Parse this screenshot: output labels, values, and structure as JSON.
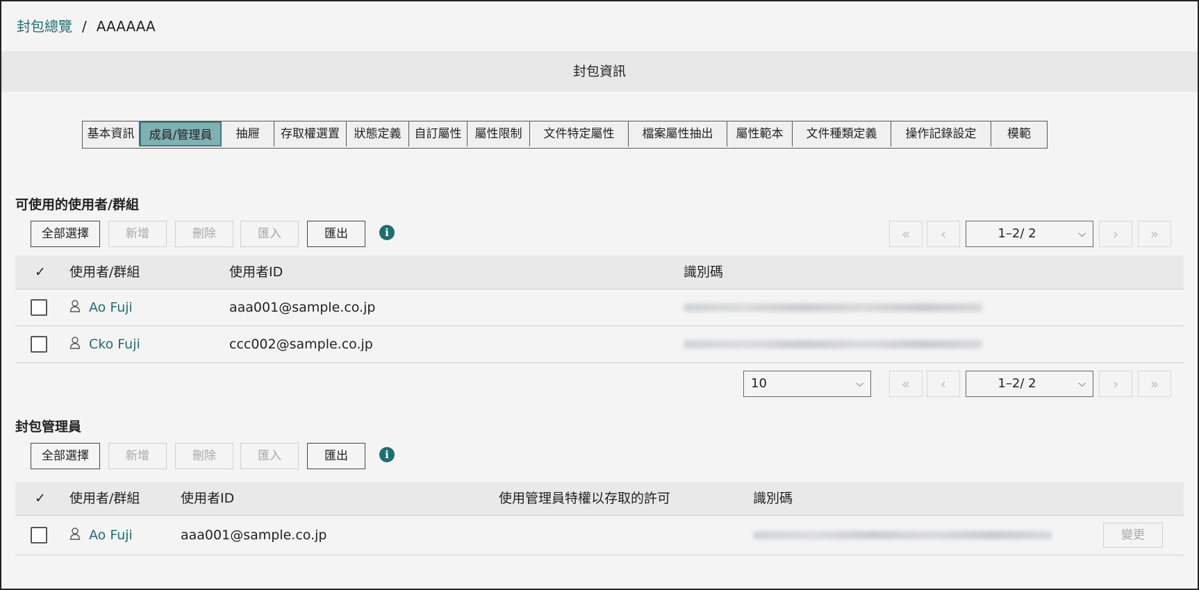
{
  "breadcrumb": {
    "root": "封包總覽",
    "separator": "/",
    "current": "AAAAAA"
  },
  "title_bar": "封包資訊",
  "tabs": [
    {
      "label": "基本資訊",
      "active": false
    },
    {
      "label": "成員/管理員",
      "active": true
    },
    {
      "label": "抽屜",
      "active": false
    },
    {
      "label": "存取權選置",
      "active": false
    },
    {
      "label": "狀態定義",
      "active": false
    },
    {
      "label": "自訂屬性",
      "active": false
    },
    {
      "label": "屬性限制",
      "active": false
    },
    {
      "label": "文件特定屬性",
      "active": false
    },
    {
      "label": "檔案屬性抽出",
      "active": false
    },
    {
      "label": "屬性範本",
      "active": false
    },
    {
      "label": "文件種類定義",
      "active": false
    },
    {
      "label": "操作記錄設定",
      "active": false
    },
    {
      "label": "模範",
      "active": false
    }
  ],
  "members": {
    "title": "可使用的使用者/群組",
    "toolbar": {
      "select_all": "全部選擇",
      "add": "新增",
      "delete": "刪除",
      "import": "匯入",
      "export": "匯出",
      "info": "i"
    },
    "pager_top": {
      "first": "«",
      "prev": "‹",
      "page": "1–2/ 2",
      "next": "›",
      "last": "»"
    },
    "headers": {
      "check": "✓",
      "user": "使用者/群組",
      "user_id": "使用者ID",
      "identifier": "識別碼"
    },
    "rows": [
      {
        "name": "Ao Fuji",
        "user_id": "aaa001@sample.co.jp"
      },
      {
        "name": "Cko Fuji",
        "user_id": "ccc002@sample.co.jp"
      }
    ],
    "page_size": "10",
    "pager_bottom": {
      "first": "«",
      "prev": "‹",
      "page": "1–2/ 2",
      "next": "›",
      "last": "»"
    }
  },
  "admins": {
    "title": "封包管理員",
    "toolbar": {
      "select_all": "全部選擇",
      "add": "新增",
      "delete": "刪除",
      "import": "匯入",
      "export": "匯出",
      "info": "i"
    },
    "headers": {
      "check": "✓",
      "user": "使用者/群組",
      "user_id": "使用者ID",
      "permission": "使用管理員特權以存取的許可",
      "identifier": "識別碼"
    },
    "rows": [
      {
        "name": "Ao Fuji",
        "user_id": "aaa001@sample.co.jp",
        "change": "變更"
      }
    ]
  },
  "colors": {
    "accent": "#1d6f6f",
    "active_tab": "#7fb0b2",
    "background": "#f4f4f4"
  }
}
